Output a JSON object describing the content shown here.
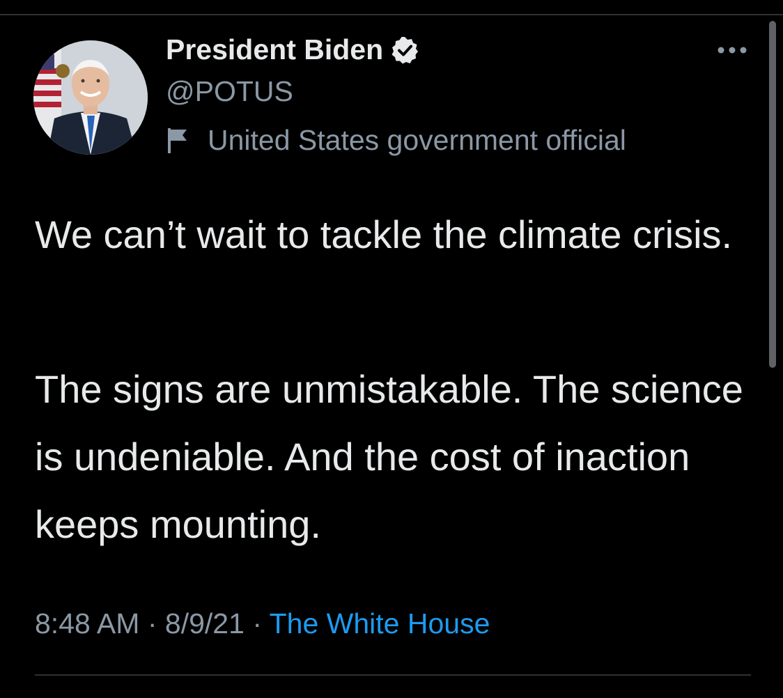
{
  "user": {
    "display_name": "President Biden",
    "handle": "@POTUS",
    "label": "United States government official",
    "verified_icon": "verified-badge-icon",
    "label_icon": "flag-icon",
    "more_icon": "ellipsis-icon"
  },
  "tweet": {
    "paragraphs": [
      "We can’t wait to tackle the climate crisis.",
      "The signs are unmistakable. The science is undeniable. And the cost of inaction keeps mounting."
    ],
    "time": "8:48 AM",
    "date": "8/9/21",
    "separator": "·",
    "source": "The White House"
  },
  "colors": {
    "background": "#000000",
    "text_primary": "#e7e9ea",
    "text_secondary": "#8b98a5",
    "link": "#1d9bf0",
    "divider": "#2f3336"
  }
}
